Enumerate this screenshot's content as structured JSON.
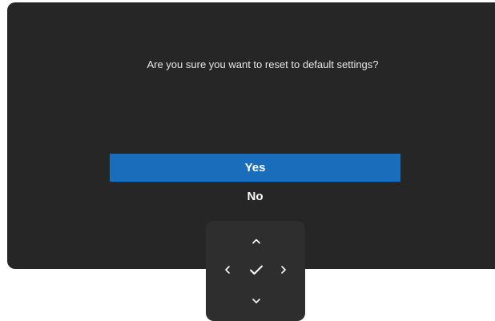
{
  "dialog": {
    "message": "Are you sure you want to reset to default settings?",
    "options": [
      {
        "label": "Yes",
        "selected": true
      },
      {
        "label": "No",
        "selected": false
      }
    ]
  },
  "navigation": {
    "keys": [
      "chevron-up-icon",
      "chevron-left-icon",
      "checkmark-icon",
      "chevron-right-icon",
      "chevron-down-icon"
    ]
  },
  "colors": {
    "panel_background": "#262626",
    "selected_highlight": "#1a6dbb",
    "nav_pad_background": "#2e2e2e",
    "text": "#ffffff"
  }
}
